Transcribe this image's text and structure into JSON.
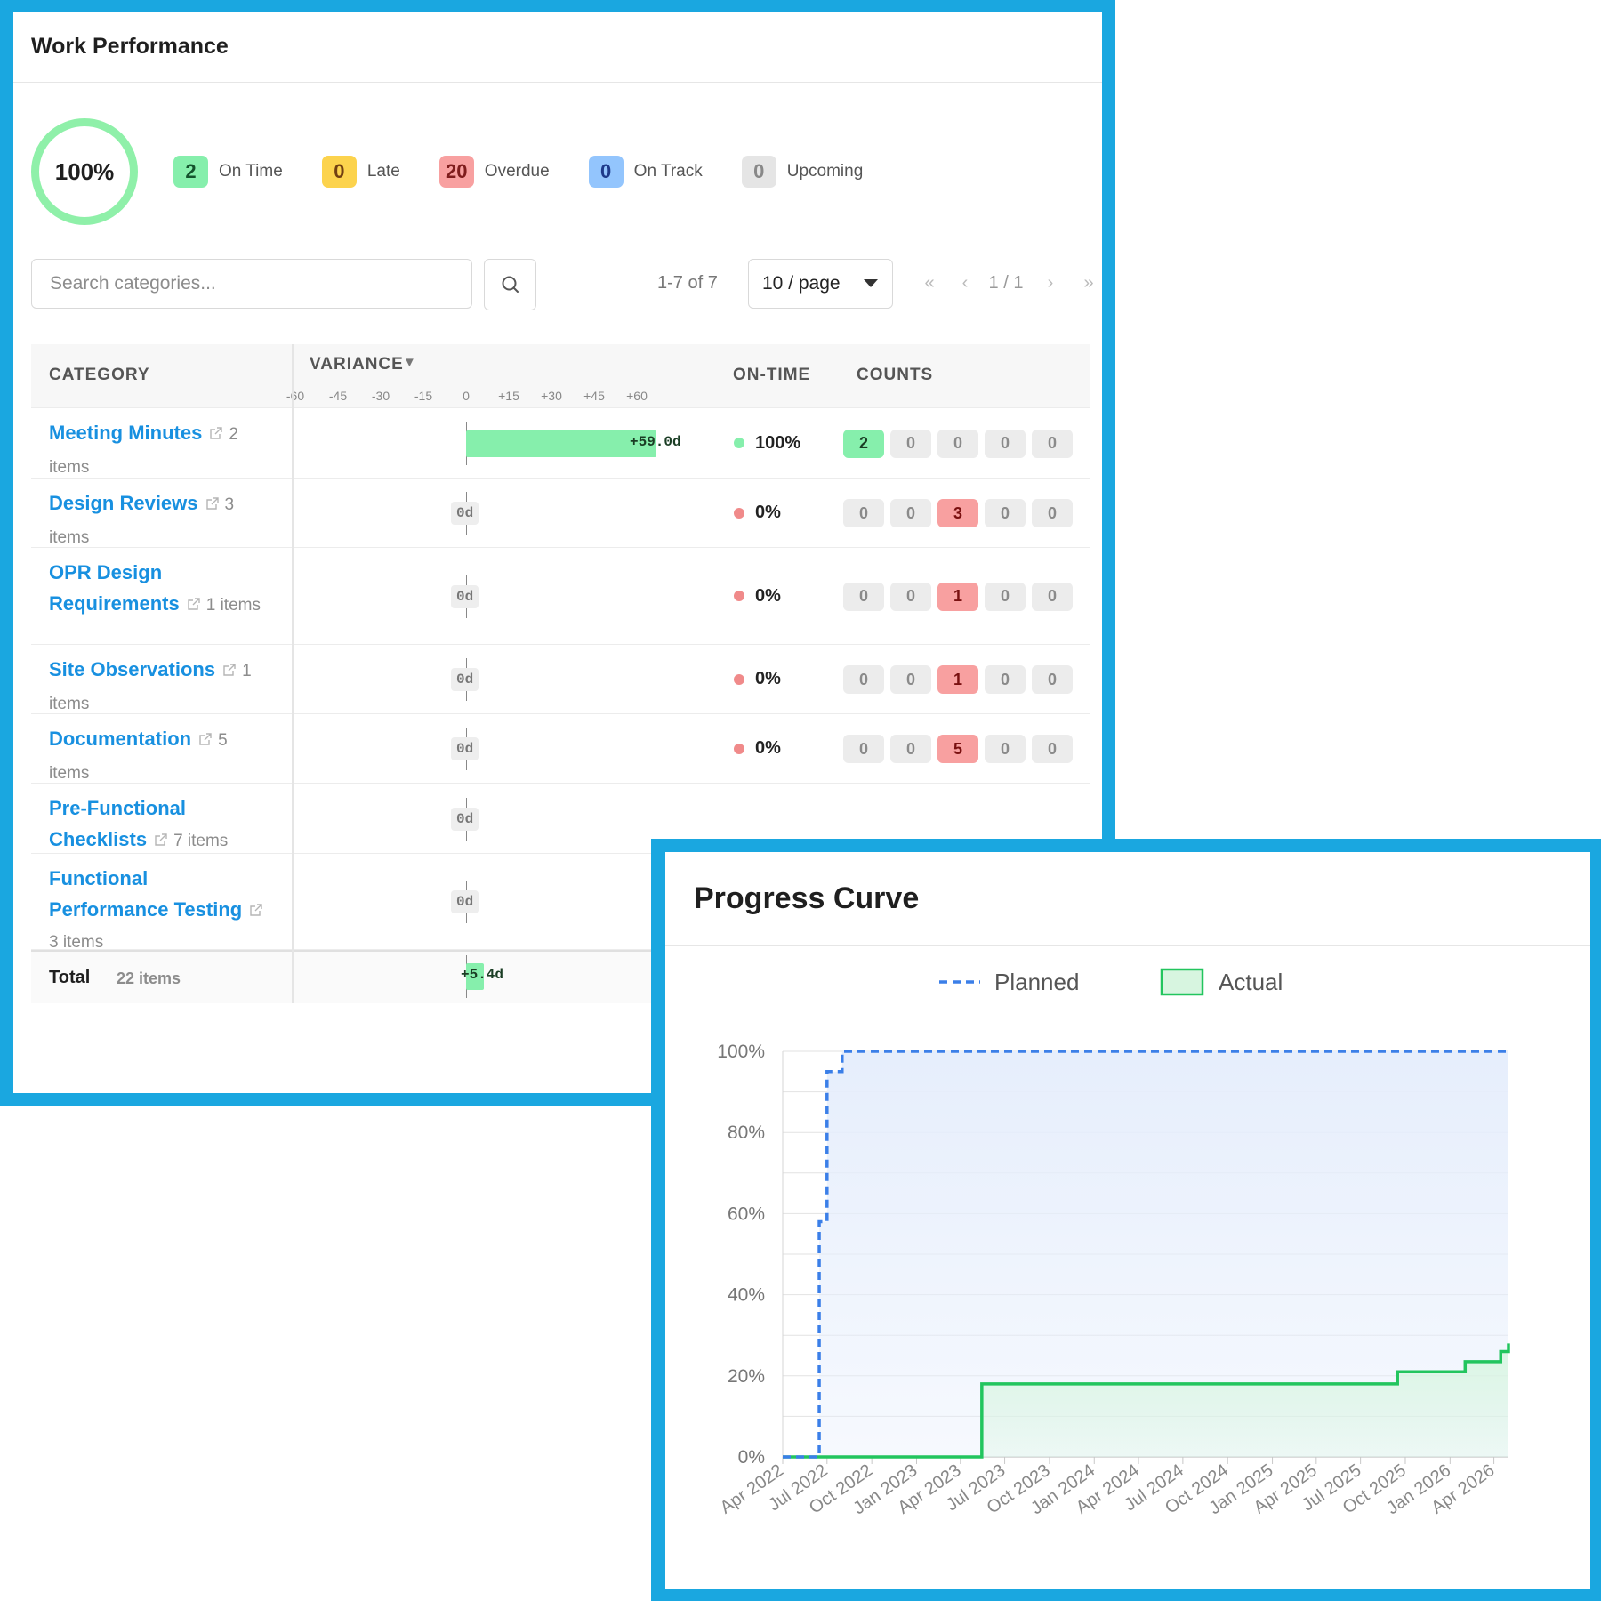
{
  "work_performance": {
    "title": "Work Performance",
    "completion": "100%",
    "stats": [
      {
        "value": "2",
        "label": "On Time",
        "bg": "#86efac",
        "fg": "#14532d"
      },
      {
        "value": "0",
        "label": "Late",
        "bg": "#fcd34d",
        "fg": "#713f12"
      },
      {
        "value": "20",
        "label": "Overdue",
        "bg": "#f8a0a0",
        "fg": "#7f1d1d"
      },
      {
        "value": "0",
        "label": "On Track",
        "bg": "#93c5fd",
        "fg": "#1e3a8a"
      },
      {
        "value": "0",
        "label": "Upcoming",
        "bg": "#e5e5e5",
        "fg": "#888888"
      }
    ],
    "search": {
      "placeholder": "Search categories..."
    },
    "pagination": {
      "range": "1-7 of 7",
      "page_size": "10 / page",
      "page": "1 / 1",
      "first": "«",
      "prev": "‹",
      "next": "›",
      "last": "»"
    },
    "table": {
      "headers": {
        "category": "CATEGORY",
        "variance": "VARIANCE",
        "sort_arrow": "▼",
        "ontime": "ON-TIME",
        "counts": "COUNTS"
      },
      "variance_ticks": [
        "-60",
        "-45",
        "-30",
        "-15",
        "0",
        "+15",
        "+30",
        "+45",
        "+60"
      ],
      "rows": [
        {
          "name": "Meeting Minutes",
          "items": "2 items",
          "variance_days": 59.0,
          "variance_label": "+59.0d",
          "ontime": "100%",
          "ontime_color": "#86efac",
          "counts": [
            "2",
            "0",
            "0",
            "0",
            "0"
          ]
        },
        {
          "name": "Design Reviews",
          "items": "3 items",
          "variance_days": 0,
          "variance_label": "0d",
          "ontime": "0%",
          "ontime_color": "#f08a8a",
          "counts": [
            "0",
            "0",
            "3",
            "0",
            "0"
          ]
        },
        {
          "name": "OPR Design Requirements",
          "items": "1 items",
          "variance_days": 0,
          "variance_label": "0d",
          "ontime": "0%",
          "ontime_color": "#f08a8a",
          "counts": [
            "0",
            "0",
            "1",
            "0",
            "0"
          ]
        },
        {
          "name": "Site Observations",
          "items": "1 items",
          "variance_days": 0,
          "variance_label": "0d",
          "ontime": "0%",
          "ontime_color": "#f08a8a",
          "counts": [
            "0",
            "0",
            "1",
            "0",
            "0"
          ]
        },
        {
          "name": "Documentation",
          "items": "5 items",
          "variance_days": 0,
          "variance_label": "0d",
          "ontime": "0%",
          "ontime_color": "#f08a8a",
          "counts": [
            "0",
            "0",
            "5",
            "0",
            "0"
          ]
        },
        {
          "name": "Pre-Functional Checklists",
          "items": "7 items",
          "variance_days": 0,
          "variance_label": "0d"
        },
        {
          "name": "Functional Performance Testing",
          "items": "3 items",
          "variance_days": 0,
          "variance_label": "0d"
        }
      ],
      "total": {
        "label": "Total",
        "items": "22 items",
        "variance_days": 5.4,
        "variance_label": "+5.4d"
      }
    }
  },
  "progress_curve": {
    "title": "Progress Curve",
    "chart_data": {
      "type": "line",
      "series": [
        {
          "name": "Planned",
          "color": "#3b7fe8",
          "style": "dashed-step",
          "points": [
            [
              "2022-04-01",
              0
            ],
            [
              "2022-06-01",
              0
            ],
            [
              "2022-06-15",
              58
            ],
            [
              "2022-07-01",
              95
            ],
            [
              "2022-08-01",
              100
            ],
            [
              "2026-05-01",
              100
            ]
          ]
        },
        {
          "name": "Actual",
          "color": "#22c55e",
          "style": "step-area",
          "points": [
            [
              "2022-04-01",
              0
            ],
            [
              "2023-05-01",
              0
            ],
            [
              "2023-05-15",
              18
            ],
            [
              "2025-09-01",
              18
            ],
            [
              "2025-09-15",
              21
            ],
            [
              "2026-01-15",
              21
            ],
            [
              "2026-02-01",
              23.5
            ],
            [
              "2026-04-01",
              23.5
            ],
            [
              "2026-04-15",
              26
            ],
            [
              "2026-05-01",
              28
            ]
          ]
        }
      ],
      "x_tick_labels": [
        "Apr 2022",
        "Jul 2022",
        "Oct 2022",
        "Jan 2023",
        "Apr 2023",
        "Jul 2023",
        "Oct 2023",
        "Jan 2024",
        "Apr 2024",
        "Jul 2024",
        "Oct 2024",
        "Jan 2025",
        "Apr 2025",
        "Jul 2025",
        "Oct 2025",
        "Jan 2026",
        "Apr 2026"
      ],
      "y_tick_labels": [
        "0%",
        "20%",
        "40%",
        "60%",
        "80%",
        "100%"
      ],
      "xlim": [
        "2022-04-01",
        "2026-05-01"
      ],
      "ylim": [
        0,
        100
      ],
      "grid": true,
      "legend": "top-center",
      "planned_fill": "#e6eefc",
      "actual_fill": "#d7f5e0"
    }
  }
}
